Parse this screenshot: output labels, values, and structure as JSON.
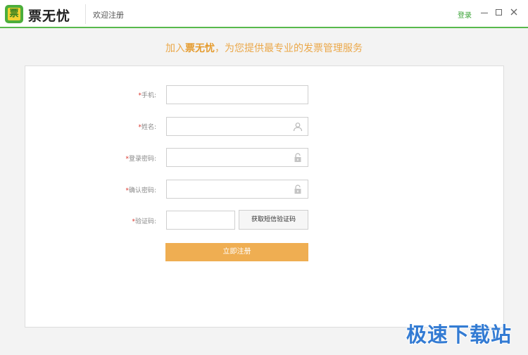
{
  "app": {
    "name": "票无忧",
    "logo_glyph": "票",
    "window_title": "欢迎注册",
    "login_link": "登录",
    "accent_color": "#58b94c"
  },
  "banner": {
    "prefix": "加入",
    "brand": "票无忧",
    "suffix": "，为您提供最专业的发票管理服务"
  },
  "form": {
    "required_mark": "*",
    "phone_label": "手机:",
    "name_label": "姓名:",
    "password_label": "登录密码:",
    "confirm_label": "确认密码:",
    "code_label": "验证码:",
    "phone_value": "",
    "name_value": "",
    "password_value": "",
    "confirm_value": "",
    "code_value": "",
    "sms_button": "获取短信验证码",
    "submit_button": "立即注册"
  },
  "watermark": "极速下载站"
}
